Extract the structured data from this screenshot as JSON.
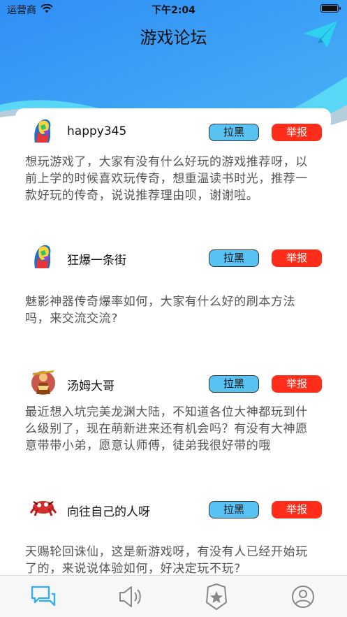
{
  "status_bar": {
    "carrier": "运营商",
    "time": "下午2:04"
  },
  "header": {
    "title": "游戏论坛",
    "send_icon": "paper-plane-icon"
  },
  "buttons": {
    "block_label": "拉黑",
    "report_label": "举报"
  },
  "posts": [
    {
      "username": "happy345",
      "avatar": "colorful-portrait-avatar",
      "text": "想玩游戏了，大家有没有什么好玩的游戏推荐呀，以前上学的时候喜欢玩传奇，想重温读书时光，推荐一款好玩的传奇，说说推荐理由呗，谢谢啦。"
    },
    {
      "username": "狂爆一条街",
      "avatar": "colorful-portrait-avatar",
      "text": "魅影神器传奇爆率如何，大家有什么好的刷本方法吗，来交流交流?"
    },
    {
      "username": "汤姆大哥",
      "avatar": "warrior-avatar",
      "text": "最近想入坑完美龙渊大陆，不知道各位大神都玩到什么级别了，现在萌新进来还有机会吗？有没有大神愿意带带小弟，愿意认师傅，徒弟我很好带的哦"
    },
    {
      "username": "向往自己的人呀",
      "avatar": "red-creature-avatar",
      "text": "天赐轮回诛仙，这是新游戏呀，有没有人已经开始玩了的，来说说体验如何，好决定玩不玩?"
    }
  ],
  "tabbar": [
    {
      "icon": "chat-icon",
      "active": true
    },
    {
      "icon": "speaker-icon",
      "active": false
    },
    {
      "icon": "badge-star-icon",
      "active": false
    },
    {
      "icon": "user-icon",
      "active": false
    }
  ],
  "colors": {
    "header_blue": "#3a9bf5",
    "wave_cyan": "#5ad6f7",
    "block_button": "#58c3f3",
    "report_button": "#ff2d1a",
    "tab_active": "#3ab0e8",
    "tab_inactive": "#888888"
  }
}
